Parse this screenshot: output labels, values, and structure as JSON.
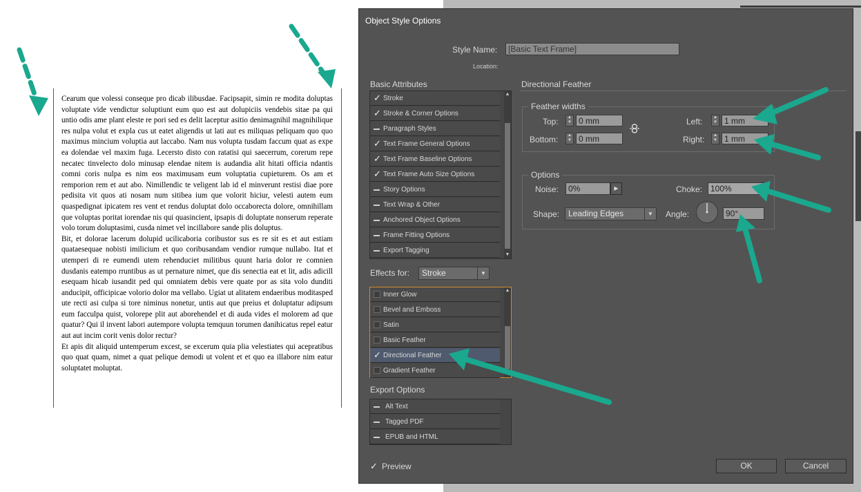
{
  "document": {
    "paragraphs": [
      "Cearum que volessi conseque pro dicab ilibusdae. Facipsapit, simin re modita doluptas voluptate vide vendictur soluptiunt eum quo est aut dolupiciis vendebis sitae pa qui untio odis ame plant eleste re pori sed es delit laceptur asitio denimagnihil magnihilique res nulpa volut et expla cus ut eatet aligendis ut lati aut es miliquas peliquam quo quo maximus mincium voluptia aut laccabo. Nam nus volupta tusdam faccum quat as expe ea dolendae vel maxim fuga. Lecersto disto con ratatisi qui saecerrum, corerum repe necatec tinvelecto dolo minusap elendae nitem is audandia alit hitati officia ndantis comni coris nulpa es nim eos maximusam eum voluptatia cupieturem. Os am et remporion rem et aut abo. Nimillendic te veligent lab id el minverunt restisi diae pore pedisita vit quos ati nosam num sitibea ium que volorit hiciur, velesti autem eum quaspedignat ipicatem res vent et rendus doluptat dolo occaborecta dolore, omnihillam que voluptas poritat iorendae nis qui quasincient, ipsapis di doluptate nonserum reperate volo torum doluptasimi, cusda nimet vel incillabore sande plis doluptus.",
      "Bit, et dolorae lacerum dolupid ucilicaboria coribustor sus es re sit es et aut estiam quataesequae nobisti imilicium et quo coribusandam vendior rumque nullabo. Itat et utemperi di re eumendi utem rehenduciet militibus quunt haria dolor re comnien dusdanis eatempo rruntibus as ut pernature nimet, que dis senectia eat et lit, adis adicill esequam hicab iusandit ped qui omniatem debis vere quate por as sita volo dunditi anducipit, officipicae volorio dolor ma vellabo. Ugiat ut alitatem endaeribus moditasped ute recti asi culpa si tore niminus nonetur, untis aut que preius et doluptatur adipsum eum facculpa quist, volorepe plit aut aborehendel et di auda vides el molorem ad que quatur? Qui il invent labori autempore volupta temquun torumen danihicatus repel eatur aut aut incim corit venis dolor rectur?",
      "Et apis dit aliquid untemperum excest, se excerum quia plia velestiates qui acepratibus quo quat quam, nimet a quat pelique demodi ut volent et et quo ea illabore nim eatur soluptatet moluptat."
    ]
  },
  "dialog": {
    "title": "Object Style Options",
    "style_name_label": "Style Name:",
    "style_name_value": "[Basic Text Frame]",
    "location_label": "Location:",
    "basic_attributes_title": "Basic Attributes",
    "basic_attributes": [
      {
        "label": "Stroke",
        "state": "checked"
      },
      {
        "label": "Stroke & Corner Options",
        "state": "checked"
      },
      {
        "label": "Paragraph Styles",
        "state": "dash"
      },
      {
        "label": "Text Frame General Options",
        "state": "checked"
      },
      {
        "label": "Text Frame Baseline Options",
        "state": "checked"
      },
      {
        "label": "Text Frame Auto Size Options",
        "state": "checked"
      },
      {
        "label": "Story Options",
        "state": "dash"
      },
      {
        "label": "Text Wrap & Other",
        "state": "dash"
      },
      {
        "label": "Anchored Object Options",
        "state": "dash"
      },
      {
        "label": "Frame Fitting Options",
        "state": "dash"
      },
      {
        "label": "Export Tagging",
        "state": "dash"
      }
    ],
    "effects_for_label": "Effects for:",
    "effects_for_value": "Stroke",
    "effects": [
      {
        "label": "Inner Glow",
        "state": "unchecked"
      },
      {
        "label": "Bevel and Emboss",
        "state": "unchecked"
      },
      {
        "label": "Satin",
        "state": "unchecked"
      },
      {
        "label": "Basic Feather",
        "state": "unchecked"
      },
      {
        "label": "Directional Feather",
        "state": "checked",
        "selected": true
      },
      {
        "label": "Gradient Feather",
        "state": "unchecked"
      }
    ],
    "export_options_title": "Export Options",
    "export_options": [
      {
        "label": "Alt Text",
        "state": "dash"
      },
      {
        "label": "Tagged PDF",
        "state": "dash"
      },
      {
        "label": "EPUB and HTML",
        "state": "dash"
      }
    ],
    "panel_title": "Directional Feather",
    "feather_widths_title": "Feather widths",
    "top_label": "Top:",
    "top_value": "0 mm",
    "bottom_label": "Bottom:",
    "bottom_value": "0 mm",
    "left_label": "Left:",
    "left_value": "1 mm",
    "right_label": "Right:",
    "right_value": "1 mm",
    "options_title": "Options",
    "noise_label": "Noise:",
    "noise_value": "0%",
    "choke_label": "Choke:",
    "choke_value": "100%",
    "shape_label": "Shape:",
    "shape_value": "Leading Edges",
    "angle_label": "Angle:",
    "angle_value": "90°",
    "preview_label": "Preview",
    "ok_label": "OK",
    "cancel_label": "Cancel"
  },
  "colors": {
    "arrow": "#1aa88e",
    "dialog_bg": "#535353",
    "selected_row": "#4f5a6e"
  }
}
